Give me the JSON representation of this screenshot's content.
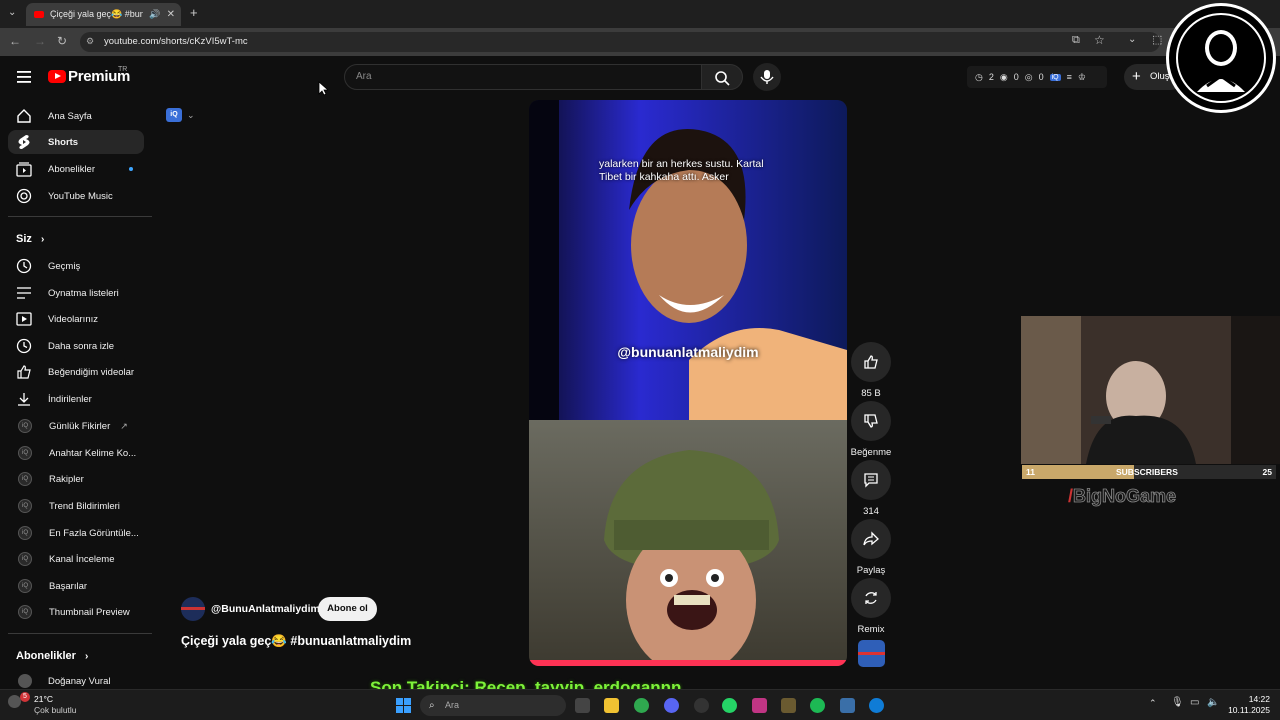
{
  "browser": {
    "tab_title": "Çiçeği yala geç😂 #bunuan",
    "url": "youtube.com/shorts/cKzVI5wT-mc"
  },
  "header": {
    "logo": "Premium",
    "logo_region": "TR",
    "search_placeholder": "Ara",
    "stats": {
      "a": "2",
      "b": "0",
      "c": "0"
    },
    "create_label": "Oluş"
  },
  "sidebar": {
    "top_items": [
      {
        "label": "Ana Sayfa",
        "icon": "home-icon"
      },
      {
        "label": "Shorts",
        "icon": "shorts-icon"
      },
      {
        "label": "Abonelikler",
        "icon": "subscriptions-icon"
      },
      {
        "label": "YouTube Music",
        "icon": "music-icon"
      }
    ],
    "you_heading": "Siz",
    "you_items": [
      {
        "label": "Geçmiş"
      },
      {
        "label": "Oynatma listeleri"
      },
      {
        "label": "Videolarınız"
      },
      {
        "label": "Daha sonra izle"
      },
      {
        "label": "Beğendiğim videolar"
      },
      {
        "label": "İndirilenler"
      }
    ],
    "ext_items": [
      {
        "label": "Günlük Fikirler"
      },
      {
        "label": "Anahtar Kelime Ko..."
      },
      {
        "label": "Rakipler"
      },
      {
        "label": "Trend Bildirimleri"
      },
      {
        "label": "En Fazla Görüntüle..."
      },
      {
        "label": "Kanal İnceleme"
      },
      {
        "label": "Başarılar"
      },
      {
        "label": "Thumbnail Preview"
      }
    ],
    "subs_heading": "Abonelikler",
    "subs_item": "Doğanay Vural"
  },
  "short": {
    "caption": "yalarken bir an herkes sustu. Kartal Tibet bir kahkaha attı. Asker",
    "watermark": "@bunuanlatmaliydim",
    "channel": "@BunuAnlatmaliydim",
    "subscribe": "Abone ol",
    "title": "Çiçeği yala geç😂 #bunuanlatmaliydim",
    "likes": "85 B",
    "dislike": "Beğenme",
    "comments": "314",
    "share": "Paylaş",
    "remix": "Remix"
  },
  "overlay": {
    "subs_left": "11",
    "subs_label": "SUBSCRIBERS",
    "subs_right": "25",
    "brand": "BigNoGame",
    "ticker": "Son Takipçi: Recep_tayyip_erdogannn"
  },
  "taskbar": {
    "weather_temp": "21°C",
    "weather_text": "Çok bulutlu",
    "search": "Ara",
    "time": "14:22",
    "date": "10.11.2025",
    "badge": "5"
  }
}
